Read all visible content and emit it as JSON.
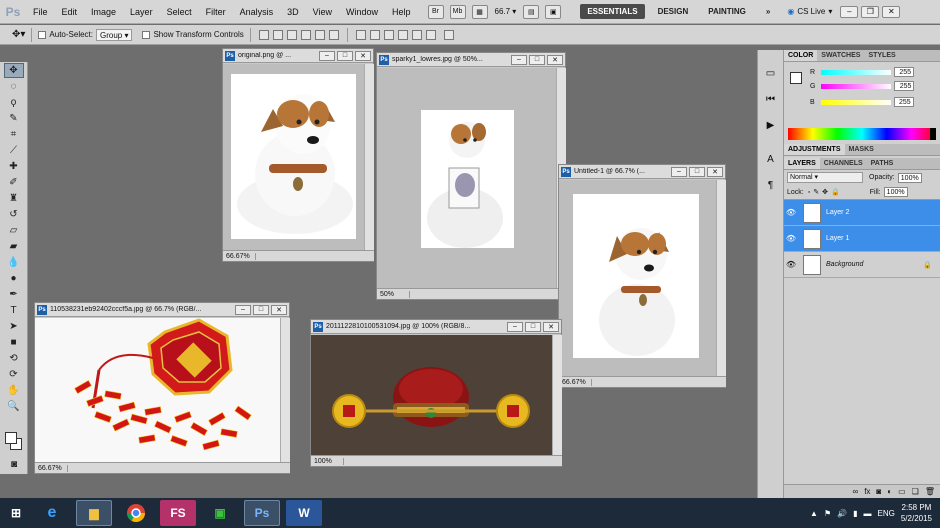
{
  "app": {
    "logo": "Ps"
  },
  "menu": [
    "File",
    "Edit",
    "Image",
    "Layer",
    "Select",
    "Filter",
    "Analysis",
    "3D",
    "View",
    "Window",
    "Help"
  ],
  "menubar": {
    "br_label": "Br",
    "mb_label": "Mb",
    "zoom_value": "66.7",
    "workspaces": [
      "ESSENTIALS",
      "DESIGN",
      "PAINTING"
    ],
    "more": "»",
    "cs_live": "CS Live"
  },
  "options": {
    "auto_select_label": "Auto-Select:",
    "auto_select_value": "Group",
    "show_transform_label": "Show Transform Controls"
  },
  "documents": [
    {
      "title": "original.png @ ...",
      "zoom": "66.67%"
    },
    {
      "title": "sparky1_lowres.jpg @ 50%...",
      "zoom": "50%"
    },
    {
      "title": "Untitled-1 @ 66.7% (...",
      "zoom": "66.67%"
    },
    {
      "title": "110538231eb92402cccf5a.jpg @ 66.7% (RGB/...",
      "zoom": "66.67%"
    },
    {
      "title": "2011122810100531094.jpg @ 100% (RGB/8...",
      "zoom": "100%"
    }
  ],
  "color_panel": {
    "tabs": [
      "COLOR",
      "SWATCHES",
      "STYLES"
    ],
    "channels": [
      {
        "label": "R",
        "value": "255"
      },
      {
        "label": "G",
        "value": "255"
      },
      {
        "label": "B",
        "value": "255"
      }
    ]
  },
  "adjustments_tabs": [
    "ADJUSTMENTS",
    "MASKS"
  ],
  "layers_panel": {
    "tabs": [
      "LAYERS",
      "CHANNELS",
      "PATHS"
    ],
    "blend_mode": "Normal",
    "opacity_label": "Opacity:",
    "opacity": "100%",
    "lock_label": "Lock:",
    "fill_label": "Fill:",
    "fill": "100%",
    "layers": [
      {
        "name": "Layer 2"
      },
      {
        "name": "Layer 1"
      },
      {
        "name": "Background"
      }
    ]
  },
  "taskbar": {
    "apps": [
      "ie-icon",
      "file-explorer-icon",
      "chrome-icon",
      "fs-app-icon",
      "store-icon",
      "photoshop-icon",
      "word-icon"
    ],
    "fs_label": "FS",
    "ps_label": "Ps",
    "word_label": "W",
    "lang": "ENG",
    "time": "2:58 PM",
    "date": "5/2/2015"
  },
  "colors": {
    "selection": "#3d8ee8",
    "taskbar": "#1c2a3a",
    "workspace": "#6e6e6e"
  }
}
